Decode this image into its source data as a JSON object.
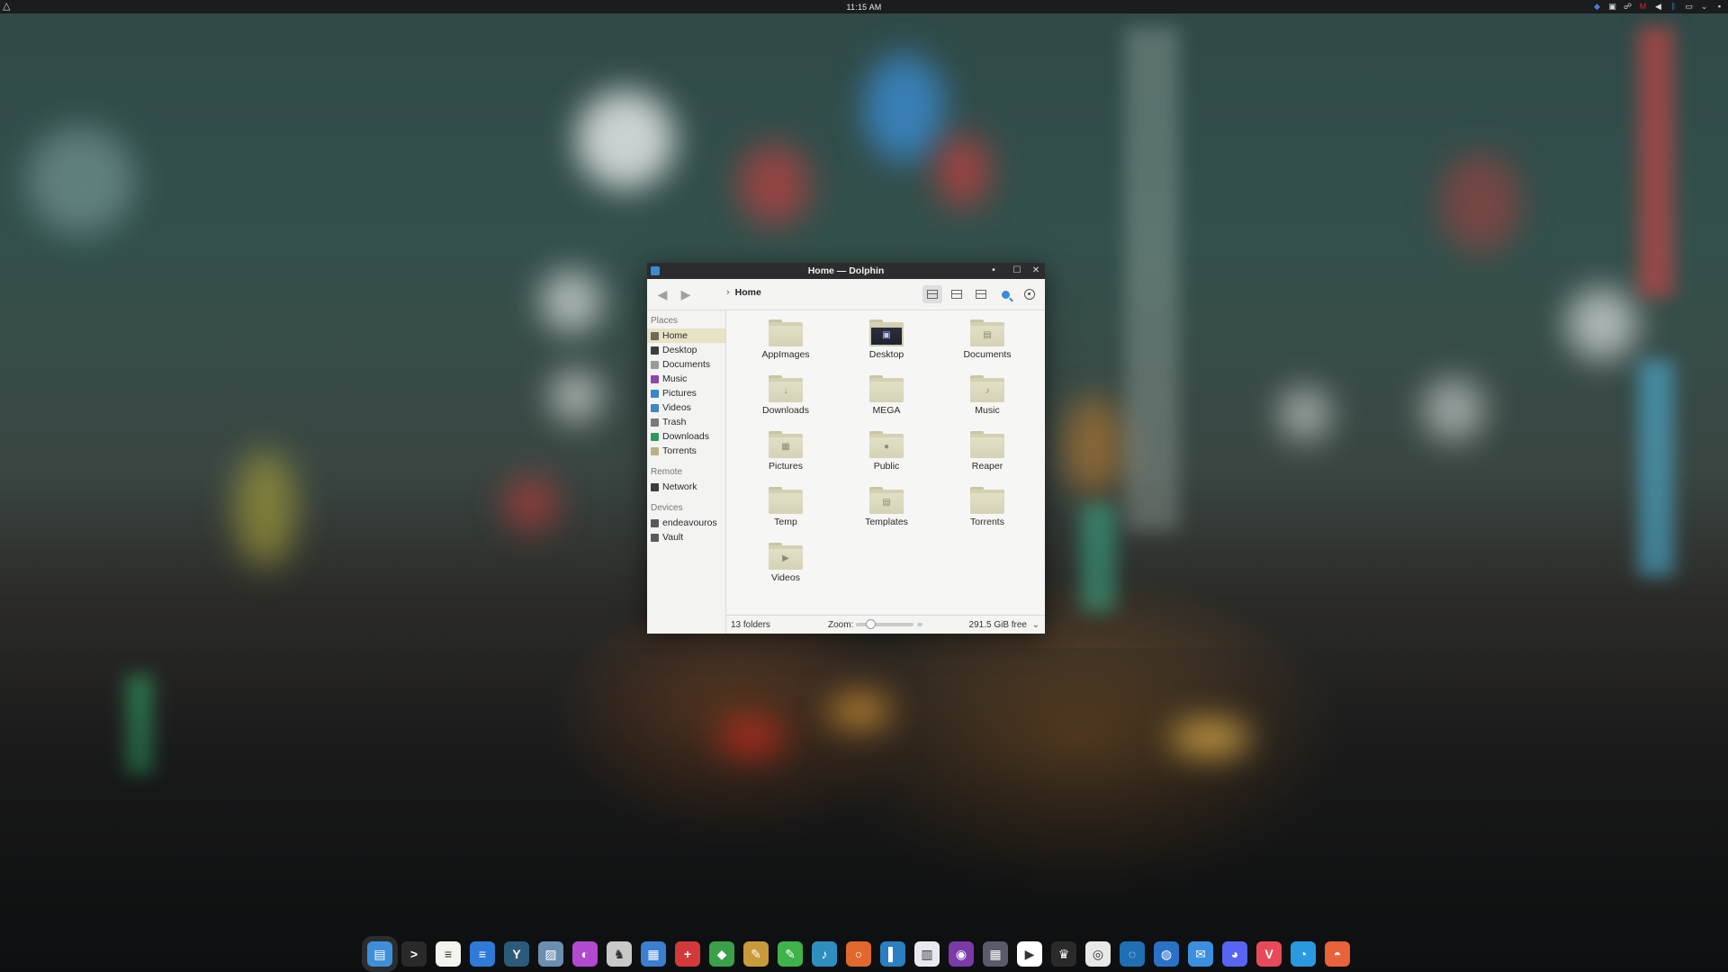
{
  "top_panel": {
    "clock": "11:15 AM",
    "launcher_icon": "endeavouros-icon",
    "tray_icons": [
      "bitwarden-icon",
      "clipboard-icon",
      "kde-connect-icon",
      "mega-icon",
      "volume-icon",
      "bluetooth-icon",
      "display-icon",
      "chevron-down-icon",
      "window-icon"
    ]
  },
  "window": {
    "title": "Home — Dolphin",
    "breadcrumb": {
      "current": "Home"
    },
    "places": {
      "title": "Places",
      "items": [
        {
          "label": "Home",
          "icon": "home-icon",
          "color": "#6b6b5a",
          "selected": true
        },
        {
          "label": "Desktop",
          "icon": "desktop-icon",
          "color": "#3d3d3d"
        },
        {
          "label": "Documents",
          "icon": "documents-icon",
          "color": "#9a9a9a"
        },
        {
          "label": "Music",
          "icon": "music-icon",
          "color": "#8e44ad"
        },
        {
          "label": "Pictures",
          "icon": "pictures-icon",
          "color": "#3a87c7"
        },
        {
          "label": "Videos",
          "icon": "videos-icon",
          "color": "#3a87c7"
        },
        {
          "label": "Trash",
          "icon": "trash-icon",
          "color": "#7a7a7a"
        },
        {
          "label": "Downloads",
          "icon": "downloads-icon",
          "color": "#2e9a5b"
        },
        {
          "label": "Torrents",
          "icon": "folder-icon",
          "color": "#b8b089"
        }
      ]
    },
    "remote": {
      "title": "Remote",
      "items": [
        {
          "label": "Network",
          "icon": "network-icon",
          "color": "#3d3d3d"
        }
      ]
    },
    "devices": {
      "title": "Devices",
      "items": [
        {
          "label": "endeavouros",
          "icon": "drive-icon",
          "color": "#5a5a5a"
        },
        {
          "label": "Vault",
          "icon": "vault-icon",
          "color": "#5a5a5a"
        }
      ]
    },
    "folders": [
      {
        "label": "AppImages",
        "emblem": ""
      },
      {
        "label": "Desktop",
        "emblem": "▣"
      },
      {
        "label": "Documents",
        "emblem": "▤"
      },
      {
        "label": "Downloads",
        "emblem": "↓"
      },
      {
        "label": "MEGA",
        "emblem": ""
      },
      {
        "label": "Music",
        "emblem": "♪"
      },
      {
        "label": "Pictures",
        "emblem": "▦"
      },
      {
        "label": "Public",
        "emblem": "●"
      },
      {
        "label": "Reaper",
        "emblem": ""
      },
      {
        "label": "Temp",
        "emblem": ""
      },
      {
        "label": "Templates",
        "emblem": "▤"
      },
      {
        "label": "Torrents",
        "emblem": ""
      },
      {
        "label": "Videos",
        "emblem": "▶"
      }
    ],
    "status": {
      "count": "13 folders",
      "zoom_label": "Zoom:",
      "zoom_level": 0.25,
      "free_space": "291.5 GiB free"
    }
  },
  "dock": {
    "items": [
      {
        "name": "dolphin-icon",
        "color": "#3f8fd8",
        "glyph": "▤"
      },
      {
        "name": "terminal-icon",
        "color": "#2a2a2a",
        "glyph": ">"
      },
      {
        "name": "text-editor-icon",
        "color": "#f4f4ee",
        "glyph": "≡"
      },
      {
        "name": "writer-icon",
        "color": "#2f7ad6",
        "glyph": "≡"
      },
      {
        "name": "yakuake-icon",
        "color": "#2c5a7a",
        "glyph": "Y"
      },
      {
        "name": "image-viewer-icon",
        "color": "#6b8fb0",
        "glyph": "▨"
      },
      {
        "name": "color-picker-icon",
        "color": "#b14ad0",
        "glyph": "◐"
      },
      {
        "name": "chess-icon",
        "color": "#c9c9c9",
        "glyph": "♞"
      },
      {
        "name": "spreadsheet-icon",
        "color": "#3a7fd0",
        "glyph": "▦"
      },
      {
        "name": "first-aid-icon",
        "color": "#d23a3a",
        "glyph": "+"
      },
      {
        "name": "vpn-shield-icon",
        "color": "#3aa04a",
        "glyph": "◆"
      },
      {
        "name": "gimp-icon",
        "color": "#c99a3a",
        "glyph": "✎"
      },
      {
        "name": "inkscape-icon",
        "color": "#3eb34a",
        "glyph": "✎"
      },
      {
        "name": "music-player-icon",
        "color": "#2e8fbf",
        "glyph": "♪"
      },
      {
        "name": "obs-icon",
        "color": "#e0682c",
        "glyph": "○"
      },
      {
        "name": "sidebar-app-icon",
        "color": "#2a7fc0",
        "glyph": "▌"
      },
      {
        "name": "audio-editor-icon",
        "color": "#e8e8f0",
        "glyph": "▥"
      },
      {
        "name": "podcast-icon",
        "color": "#7a3aa8",
        "glyph": "◉"
      },
      {
        "name": "video-editor-icon",
        "color": "#5a5a6a",
        "glyph": "▦"
      },
      {
        "name": "youtube-icon",
        "color": "#ffffff",
        "glyph": "▶"
      },
      {
        "name": "game-icon",
        "color": "#2a2a2a",
        "glyph": "♛"
      },
      {
        "name": "disk-icon",
        "color": "#e8e8e8",
        "glyph": "◎"
      },
      {
        "name": "steam-icon",
        "color": "#1e6fb3",
        "glyph": "◌"
      },
      {
        "name": "browser-icon",
        "color": "#2a72c8",
        "glyph": "◍"
      },
      {
        "name": "mail-bird-icon",
        "color": "#3a8fe0",
        "glyph": "✉"
      },
      {
        "name": "discord-icon",
        "color": "#5865f2",
        "glyph": "◕"
      },
      {
        "name": "vivaldi-icon",
        "color": "#e84a5a",
        "glyph": "V"
      },
      {
        "name": "safari-icon",
        "color": "#2a9ae0",
        "glyph": "◔"
      },
      {
        "name": "firefox-icon",
        "color": "#e8623a",
        "glyph": "◓"
      }
    ]
  }
}
